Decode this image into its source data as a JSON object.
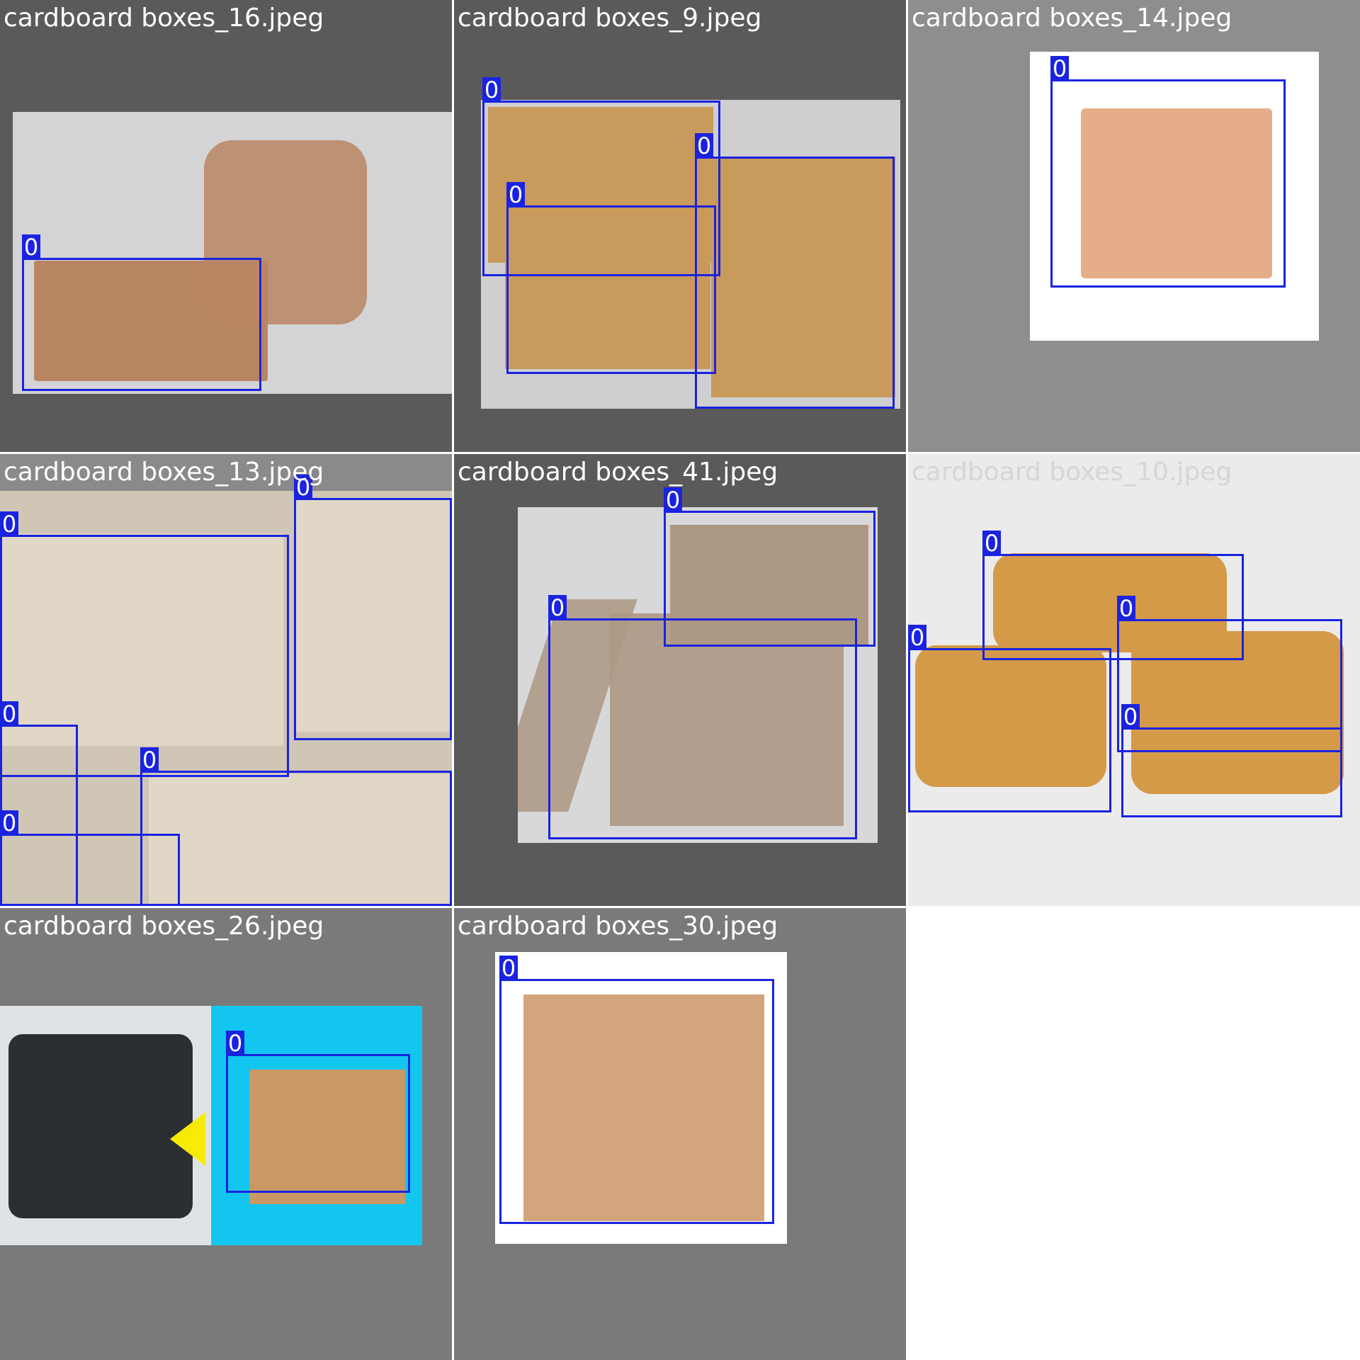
{
  "bbox_color": "#1a23e0",
  "tiles": [
    {
      "filename": "cardboard boxes_16.jpeg",
      "bg": "#5a5a5a",
      "label_color": "#ffffff",
      "photo_bg": "#d4d4d6",
      "box_color": "#b88563",
      "boxes": [
        {
          "cls": "0"
        }
      ]
    },
    {
      "filename": "cardboard boxes_9.jpeg",
      "bg": "#5a5a5a",
      "label_color": "#ffffff",
      "photo_bg": "#cfcfd1",
      "box_color": "#c89a5c",
      "boxes": [
        {
          "cls": "0"
        },
        {
          "cls": "0"
        },
        {
          "cls": "0"
        }
      ]
    },
    {
      "filename": "cardboard boxes_14.jpeg",
      "bg": "#8e8e8e",
      "label_color": "#ffffff",
      "photo_bg": "#ffffff",
      "box_color": "#e6ad8a",
      "boxes": [
        {
          "cls": "0"
        }
      ]
    },
    {
      "filename": "cardboard boxes_13.jpeg",
      "bg": "#8a8a8a",
      "label_color": "#ffffff",
      "photo_bg": "#cfc6b6",
      "box_color": "#e0d7c7",
      "boxes": [
        {
          "cls": "0"
        },
        {
          "cls": "0"
        },
        {
          "cls": "0"
        },
        {
          "cls": "0"
        },
        {
          "cls": "0"
        }
      ]
    },
    {
      "filename": "cardboard boxes_41.jpeg",
      "bg": "#5a5a5a",
      "label_color": "#ffffff",
      "photo_bg": "#d8d8da",
      "box_color": "#ad9883",
      "boxes": [
        {
          "cls": "0"
        },
        {
          "cls": "0"
        }
      ]
    },
    {
      "filename": "cardboard boxes_10.jpeg",
      "bg": "#ebebeb",
      "label_color": "#d6d6d6",
      "photo_bg": "#ebebeb",
      "box_color": "#d49a48",
      "boxes": [
        {
          "cls": "0"
        },
        {
          "cls": "0"
        },
        {
          "cls": "0"
        },
        {
          "cls": "0"
        }
      ]
    },
    {
      "filename": "cardboard boxes_26.jpeg",
      "bg": "#7a7a7a",
      "label_color": "#ffffff",
      "photo_bg": "#12c6f0",
      "box_color": "#c99865",
      "boxes": [
        {
          "cls": "0"
        }
      ]
    },
    {
      "filename": "cardboard boxes_30.jpeg",
      "bg": "#7a7a7a",
      "label_color": "#ffffff",
      "photo_bg": "#ffffff",
      "box_color": "#d4a47c",
      "boxes": [
        {
          "cls": "0"
        }
      ]
    }
  ]
}
